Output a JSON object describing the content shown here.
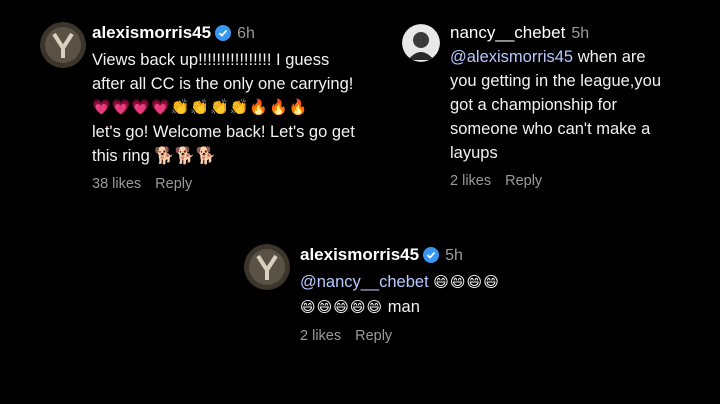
{
  "comments": [
    {
      "username": "alexismorris45",
      "time": "6h",
      "verified": true,
      "lines": [
        "Views back up!!!!!!!!!!!!!!!! I guess",
        "after all CC is the only one carrying!"
      ],
      "emoji_line": "💗💗💗💗👏👏👏👏🔥🔥🔥",
      "lines2": [
        "let's go! Welcome back! Let's go get",
        "this ring 🐕🐕🐕"
      ],
      "likes": "38 likes",
      "reply_label": "Reply"
    },
    {
      "username": "nancy__chebet",
      "time": "5h",
      "verified": false,
      "mention": "@alexismorris45",
      "first_line_rest": " when are",
      "lines": [
        "you getting in the league,you",
        "got a championship for",
        "someone who can't make a",
        "layups"
      ],
      "likes": "2 likes",
      "reply_label": "Reply"
    },
    {
      "username": "alexismorris45",
      "time": "5h",
      "verified": true,
      "mention": "@nancy__chebet",
      "emoji_line1": "😄😄😄😄",
      "emoji_line2": "😄😄😄😄😄",
      "line2_text": "man",
      "likes": "2 likes",
      "reply_label": "Reply"
    }
  ],
  "icons": {
    "verified_badge": "verified-badge-icon",
    "verified_color": "#3897f0"
  }
}
